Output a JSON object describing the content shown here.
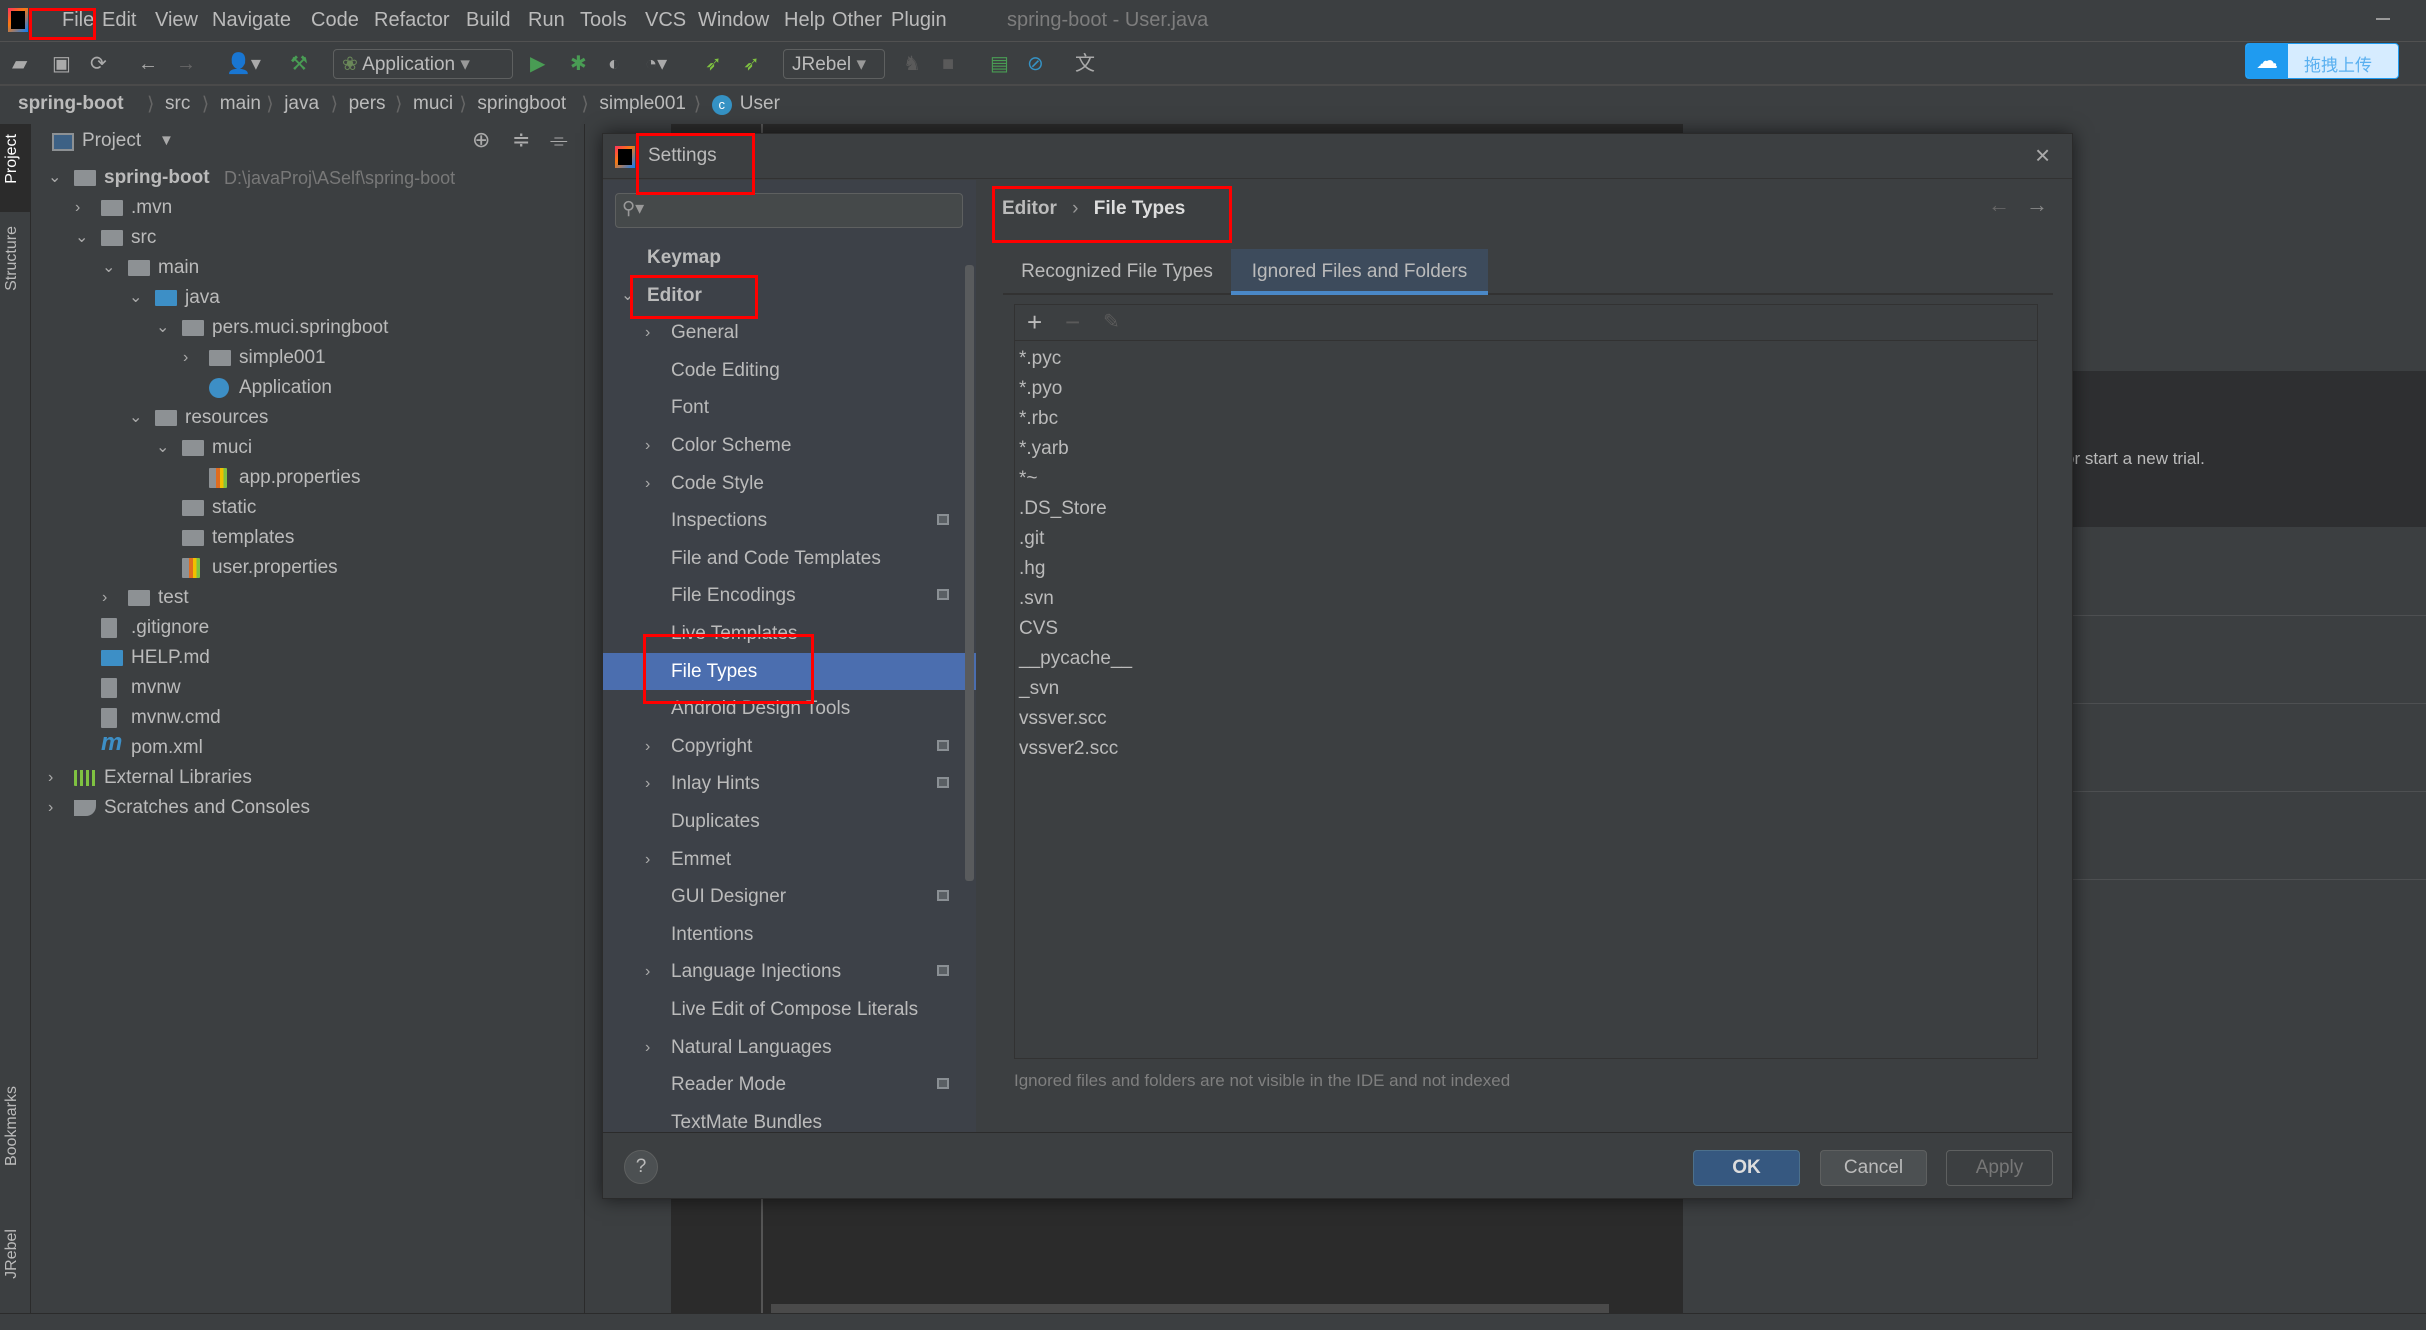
{
  "menu": {
    "items": [
      "File",
      "Edit",
      "View",
      "Navigate",
      "Code",
      "Refactor",
      "Build",
      "Run",
      "Tools",
      "VCS",
      "Window",
      "Help",
      "Other",
      "Plugin"
    ],
    "window_title": "spring-boot - User.java"
  },
  "toolbar": {
    "run_config": "Application",
    "jrebel_config": "JRebel",
    "upload_label": "拖拽上传"
  },
  "breadcrumb": [
    "spring-boot",
    "src",
    "main",
    "java",
    "pers",
    "muci",
    "springboot",
    "simple001",
    "User"
  ],
  "side_tabs": {
    "project": "Project",
    "structure": "Structure",
    "bookmarks": "Bookmarks",
    "jrebel": "JRebel"
  },
  "project_panel": {
    "title": "Project",
    "tree": [
      {
        "label": "spring-boot",
        "path": "D:\\javaProj\\ASelf\\spring-boot",
        "depth": 0,
        "arrow": "down",
        "icon": "module-folder"
      },
      {
        "label": ".mvn",
        "depth": 1,
        "arrow": "right",
        "icon": "folder"
      },
      {
        "label": "src",
        "depth": 1,
        "arrow": "down",
        "icon": "folder"
      },
      {
        "label": "main",
        "depth": 2,
        "arrow": "down",
        "icon": "folder"
      },
      {
        "label": "java",
        "depth": 3,
        "arrow": "down",
        "icon": "source-folder"
      },
      {
        "label": "pers.muci.springboot",
        "depth": 4,
        "arrow": "down",
        "icon": "package"
      },
      {
        "label": "simple001",
        "depth": 5,
        "arrow": "right",
        "icon": "package"
      },
      {
        "label": "Application",
        "depth": 5,
        "arrow": "",
        "icon": "spring-class"
      },
      {
        "label": "resources",
        "depth": 3,
        "arrow": "down",
        "icon": "resources-folder"
      },
      {
        "label": "muci",
        "depth": 4,
        "arrow": "down",
        "icon": "folder"
      },
      {
        "label": "app.properties",
        "depth": 5,
        "arrow": "",
        "icon": "properties-file"
      },
      {
        "label": "static",
        "depth": 4,
        "arrow": "",
        "icon": "folder"
      },
      {
        "label": "templates",
        "depth": 4,
        "arrow": "",
        "icon": "folder"
      },
      {
        "label": "user.properties",
        "depth": 4,
        "arrow": "",
        "icon": "properties-file"
      },
      {
        "label": "test",
        "depth": 2,
        "arrow": "right",
        "icon": "folder"
      },
      {
        "label": ".gitignore",
        "depth": 1,
        "arrow": "",
        "icon": "ignore-file"
      },
      {
        "label": "HELP.md",
        "depth": 1,
        "arrow": "",
        "icon": "markdown-file"
      },
      {
        "label": "mvnw",
        "depth": 1,
        "arrow": "",
        "icon": "shell-file"
      },
      {
        "label": "mvnw.cmd",
        "depth": 1,
        "arrow": "",
        "icon": "text-file"
      },
      {
        "label": "pom.xml",
        "depth": 1,
        "arrow": "",
        "icon": "maven-file"
      },
      {
        "label": "External Libraries",
        "depth": 0,
        "arrow": "right",
        "icon": "libraries"
      },
      {
        "label": "Scratches and Consoles",
        "depth": 0,
        "arrow": "right",
        "icon": "scratches"
      }
    ]
  },
  "background": {
    "trial_text": "or start a new trial."
  },
  "settings": {
    "title": "Settings",
    "search_placeholder": "",
    "nav": [
      {
        "label": "Keymap",
        "top": true
      },
      {
        "label": "Editor",
        "top": true,
        "expanded": true
      },
      {
        "label": "General",
        "chevron": true
      },
      {
        "label": "Code Editing"
      },
      {
        "label": "Font"
      },
      {
        "label": "Color Scheme",
        "chevron": true
      },
      {
        "label": "Code Style",
        "chevron": true
      },
      {
        "label": "Inspections",
        "project": true
      },
      {
        "label": "File and Code Templates"
      },
      {
        "label": "File Encodings",
        "project": true
      },
      {
        "label": "Live Templates"
      },
      {
        "label": "File Types",
        "selected": true
      },
      {
        "label": "Android Design Tools"
      },
      {
        "label": "Copyright",
        "chevron": true,
        "project": true
      },
      {
        "label": "Inlay Hints",
        "chevron": true,
        "project": true
      },
      {
        "label": "Duplicates"
      },
      {
        "label": "Emmet",
        "chevron": true
      },
      {
        "label": "GUI Designer",
        "project": true
      },
      {
        "label": "Intentions"
      },
      {
        "label": "Language Injections",
        "chevron": true,
        "project": true
      },
      {
        "label": "Live Edit of Compose Literals"
      },
      {
        "label": "Natural Languages",
        "chevron": true
      },
      {
        "label": "Reader Mode",
        "project": true
      },
      {
        "label": "TextMate Bundles"
      }
    ],
    "crumb": {
      "parent": "Editor",
      "current": "File Types"
    },
    "tabs": [
      {
        "label": "Recognized File Types",
        "active": false
      },
      {
        "label": "Ignored Files and Folders",
        "active": true
      }
    ],
    "ignored": [
      "*.pyc",
      "*.pyo",
      "*.rbc",
      "*.yarb",
      "*~",
      ".DS_Store",
      ".git",
      ".hg",
      ".svn",
      "CVS",
      "__pycache__",
      "_svn",
      "vssver.scc",
      "vssver2.scc"
    ],
    "hint": "Ignored files and folders are not visible in the IDE and not indexed",
    "buttons": {
      "ok": "OK",
      "cancel": "Cancel",
      "apply": "Apply",
      "help": "?"
    }
  },
  "colors": {
    "selection": "#4b6eaf",
    "highlight_box": "#ff0000",
    "ok_button": "#365880"
  }
}
